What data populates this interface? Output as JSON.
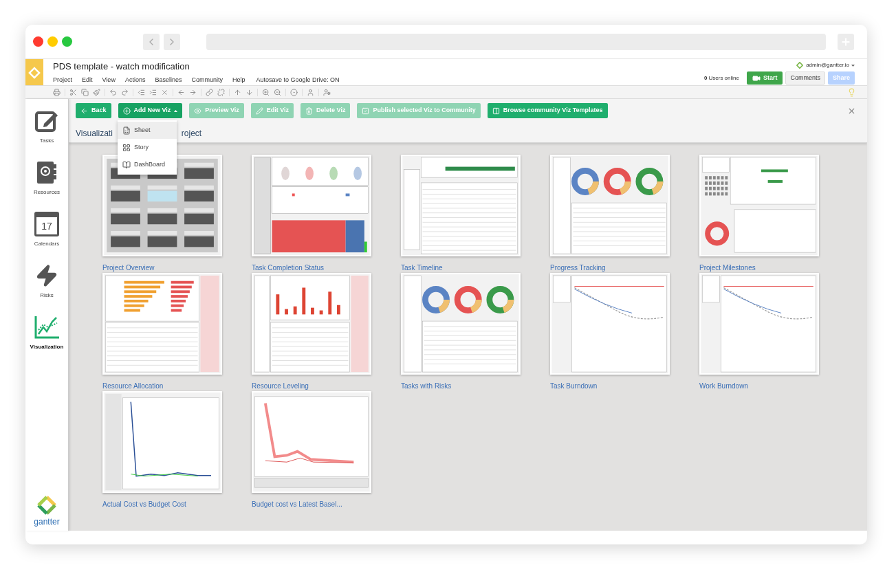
{
  "document": {
    "title": "PDS template - watch modification"
  },
  "menu": [
    "Project",
    "Edit",
    "View",
    "Actions",
    "Baselines",
    "Community",
    "Help"
  ],
  "autosave": "Autosave to Google Drive: ON",
  "account": {
    "user": "admin@gantter.io",
    "online_count": "0",
    "online_label": "Users online"
  },
  "header_buttons": [
    {
      "label": "Start",
      "kind": "video",
      "disabled": false
    },
    {
      "label": "Comments",
      "kind": "plain",
      "disabled": false
    },
    {
      "label": "Share",
      "kind": "share",
      "disabled": true
    }
  ],
  "sidebar": [
    {
      "label": "Tasks",
      "selected": false
    },
    {
      "label": "Resources",
      "selected": false
    },
    {
      "label": "Calendars",
      "badge": "17",
      "selected": false
    },
    {
      "label": "Risks",
      "selected": false
    },
    {
      "label": "Visualization",
      "selected": true
    }
  ],
  "brand": "gantter",
  "actions": [
    {
      "label": "Back",
      "disabled": false
    },
    {
      "label": "Add New Viz",
      "disabled": false,
      "expanded": true
    },
    {
      "label": "Preview Viz",
      "disabled": true
    },
    {
      "label": "Edit Viz",
      "disabled": true
    },
    {
      "label": "Delete Viz",
      "disabled": true
    },
    {
      "label": "Publish selected Viz to Community",
      "disabled": true
    },
    {
      "label": "Browse community Viz Templates",
      "disabled": false
    }
  ],
  "heading": {
    "before": "Visualizati",
    "after": "roject"
  },
  "add_menu": [
    {
      "label": "Sheet",
      "selected": true
    },
    {
      "label": "Story",
      "selected": false
    },
    {
      "label": "DashBoard",
      "selected": false
    }
  ],
  "visualizations": [
    {
      "title": "Project Overview",
      "kind": "tiles"
    },
    {
      "title": "Task Completion Status",
      "kind": "status"
    },
    {
      "title": "Task Timeline",
      "kind": "timeline"
    },
    {
      "title": "Progress Tracking",
      "kind": "donuts"
    },
    {
      "title": "Project Milestones",
      "kind": "milestones"
    },
    {
      "title": "Resource Allocation",
      "kind": "hbars"
    },
    {
      "title": "Resource Leveling",
      "kind": "columns"
    },
    {
      "title": "Tasks with Risks",
      "kind": "donuts"
    },
    {
      "title": "Task Burndown",
      "kind": "burndown"
    },
    {
      "title": "Work Burndown",
      "kind": "burndown"
    },
    {
      "title": "Actual Cost vs Budget Cost",
      "kind": "cost"
    },
    {
      "title": "Budget cost vs Latest Basel...",
      "kind": "budget"
    }
  ]
}
